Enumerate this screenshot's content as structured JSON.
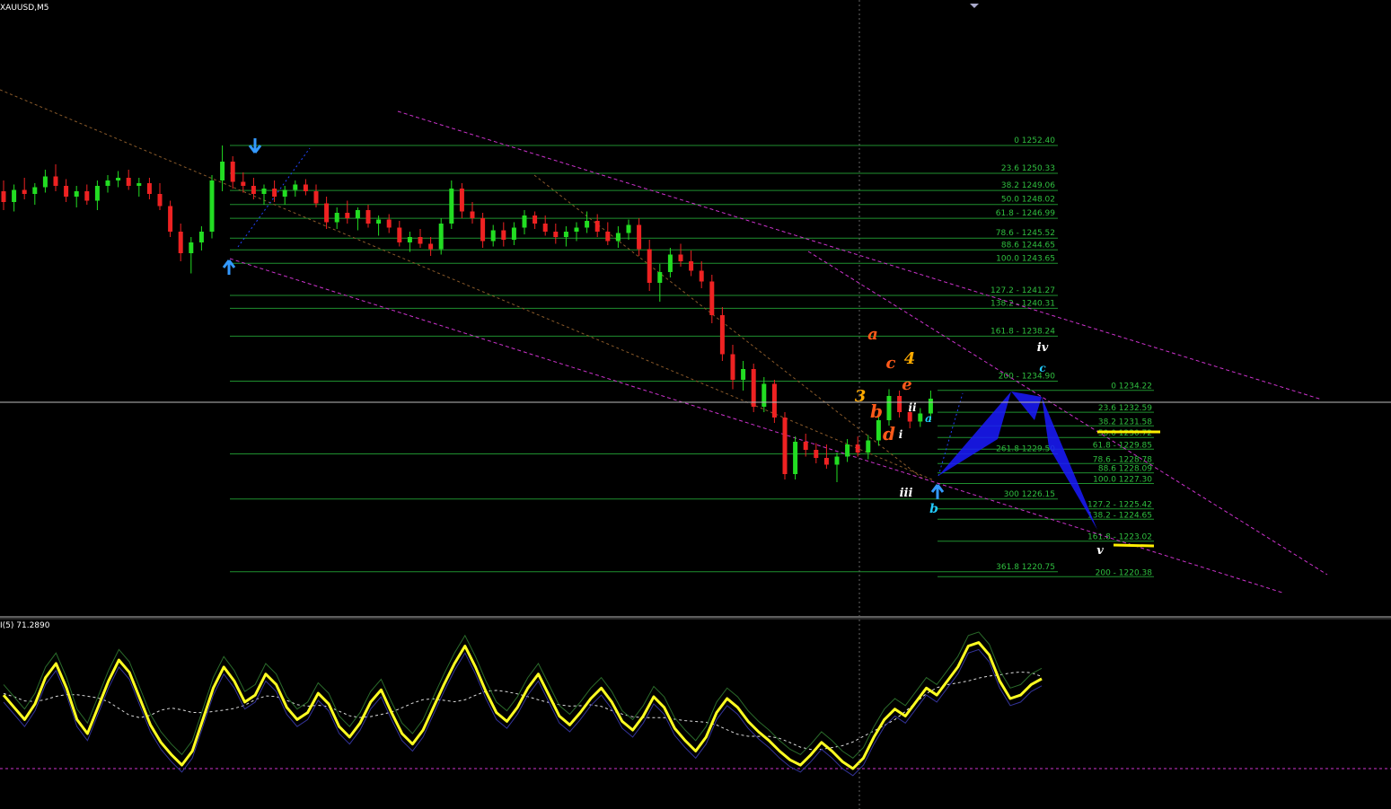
{
  "symbol_label": "XAUUSD,M5",
  "indicator_label": "I(5) 71.2890",
  "colors": {
    "background": "#000000",
    "bull": "#22dd22",
    "bear": "#ee2222",
    "fib": "#1f8f2f",
    "fib_text": "#2fbf3f",
    "channel": "#cc33cc",
    "trend": "#8a5a2a",
    "harmonic": "#1a1aff",
    "oscillator": "#ffff22",
    "arrow": "#3399ff"
  },
  "fib_left": {
    "levels": [
      {
        "price": 1252.4,
        "label": "0 1252.40"
      },
      {
        "price": 1250.33,
        "label": "23.6 1250.33"
      },
      {
        "price": 1249.06,
        "label": "38.2 1249.06"
      },
      {
        "price": 1248.02,
        "label": "50.0 1248.02"
      },
      {
        "price": 1246.99,
        "label": "61.8 - 1246.99"
      },
      {
        "price": 1245.52,
        "label": "78.6 - 1245.52"
      },
      {
        "price": 1244.65,
        "label": "88.6 1244.65"
      },
      {
        "price": 1243.65,
        "label": "100.0 1243.65"
      },
      {
        "price": 1241.27,
        "label": "127.2 - 1241.27"
      },
      {
        "price": 1240.31,
        "label": "138.2 - 1240.31"
      },
      {
        "price": 1238.24,
        "label": "161.8 - 1238.24"
      },
      {
        "price": 1234.9,
        "label": "200 - 1234.90"
      },
      {
        "price": 1229.5,
        "label": "261.8 1229.50"
      },
      {
        "price": 1226.15,
        "label": "300 1226.15"
      },
      {
        "price": 1220.75,
        "label": "361.8 1220.75"
      }
    ]
  },
  "fib_right": {
    "levels": [
      {
        "price": 1234.22,
        "label": "0 1234.22"
      },
      {
        "price": 1232.59,
        "label": "23.6 1232.59"
      },
      {
        "price": 1231.58,
        "label": "38.2 1231.58"
      },
      {
        "price": 1230.72,
        "label": "50.0 1230.72"
      },
      {
        "price": 1229.85,
        "label": "61.8 - 1229.85"
      },
      {
        "price": 1228.78,
        "label": "78.6 - 1228.78"
      },
      {
        "price": 1228.09,
        "label": "88.6 1228.09"
      },
      {
        "price": 1227.3,
        "label": "100.0 1227.30"
      },
      {
        "price": 1225.42,
        "label": "127.2 - 1225.42"
      },
      {
        "price": 1224.65,
        "label": "138.2 - 1224.65"
      },
      {
        "price": 1223.02,
        "label": "161.8 - 1223.02"
      },
      {
        "price": 1220.38,
        "label": "200 - 1220.38"
      }
    ]
  },
  "wave_labels": [
    {
      "text": "a",
      "color": "#ff5a1a"
    },
    {
      "text": "c",
      "color": "#ff5a1a"
    },
    {
      "text": "4",
      "color": "#ffaa00"
    },
    {
      "text": "e",
      "color": "#ff5a1a"
    },
    {
      "text": "3",
      "color": "#ffaa00"
    },
    {
      "text": "b",
      "color": "#ff5a1a"
    },
    {
      "text": "d",
      "color": "#ff5a1a"
    },
    {
      "text": "i",
      "color": "#ffffff"
    },
    {
      "text": "ii",
      "color": "#ffffff"
    },
    {
      "text": "iii",
      "color": "#ffffff"
    },
    {
      "text": "iv",
      "color": "#ffffff"
    },
    {
      "text": "v",
      "color": "#ffffff"
    },
    {
      "text": "a",
      "color": "#22ccff"
    },
    {
      "text": "b",
      "color": "#22ccff"
    },
    {
      "text": "c",
      "color": "#22ccff"
    }
  ],
  "chart_data": {
    "type": "candlestick",
    "title": "XAUUSD,M5",
    "price_range": [
      1216.0,
      1262.0
    ],
    "candles": [
      {
        "o": 1249.0,
        "h": 1249.8,
        "l": 1247.6,
        "c": 1248.2
      },
      {
        "o": 1248.2,
        "h": 1249.5,
        "l": 1247.5,
        "c": 1249.1
      },
      {
        "o": 1249.1,
        "h": 1250.0,
        "l": 1248.4,
        "c": 1248.8
      },
      {
        "o": 1248.8,
        "h": 1249.6,
        "l": 1248.0,
        "c": 1249.3
      },
      {
        "o": 1249.3,
        "h": 1250.6,
        "l": 1248.9,
        "c": 1250.1
      },
      {
        "o": 1250.1,
        "h": 1251.0,
        "l": 1249.0,
        "c": 1249.4
      },
      {
        "o": 1249.4,
        "h": 1249.9,
        "l": 1248.2,
        "c": 1248.6
      },
      {
        "o": 1248.6,
        "h": 1249.4,
        "l": 1247.8,
        "c": 1249.0
      },
      {
        "o": 1249.0,
        "h": 1249.5,
        "l": 1248.0,
        "c": 1248.3
      },
      {
        "o": 1248.3,
        "h": 1249.8,
        "l": 1247.6,
        "c": 1249.4
      },
      {
        "o": 1249.4,
        "h": 1250.2,
        "l": 1248.9,
        "c": 1249.8
      },
      {
        "o": 1249.8,
        "h": 1250.5,
        "l": 1249.3,
        "c": 1250.0
      },
      {
        "o": 1250.0,
        "h": 1250.6,
        "l": 1249.1,
        "c": 1249.4
      },
      {
        "o": 1249.4,
        "h": 1250.0,
        "l": 1248.6,
        "c": 1249.6
      },
      {
        "o": 1249.6,
        "h": 1250.0,
        "l": 1248.4,
        "c": 1248.8
      },
      {
        "o": 1248.8,
        "h": 1249.6,
        "l": 1247.6,
        "c": 1247.9
      },
      {
        "o": 1247.9,
        "h": 1248.3,
        "l": 1245.6,
        "c": 1246.0
      },
      {
        "o": 1246.0,
        "h": 1246.6,
        "l": 1243.8,
        "c": 1244.4
      },
      {
        "o": 1244.4,
        "h": 1245.6,
        "l": 1242.9,
        "c": 1245.2
      },
      {
        "o": 1245.2,
        "h": 1246.4,
        "l": 1244.6,
        "c": 1246.0
      },
      {
        "o": 1246.0,
        "h": 1250.2,
        "l": 1245.5,
        "c": 1249.8
      },
      {
        "o": 1249.8,
        "h": 1252.4,
        "l": 1249.0,
        "c": 1251.2
      },
      {
        "o": 1251.2,
        "h": 1251.6,
        "l": 1249.2,
        "c": 1249.7
      },
      {
        "o": 1249.7,
        "h": 1250.4,
        "l": 1248.9,
        "c": 1249.4
      },
      {
        "o": 1249.4,
        "h": 1250.0,
        "l": 1248.4,
        "c": 1248.8
      },
      {
        "o": 1248.8,
        "h": 1249.5,
        "l": 1248.0,
        "c": 1249.2
      },
      {
        "o": 1249.2,
        "h": 1249.8,
        "l": 1248.2,
        "c": 1248.6
      },
      {
        "o": 1248.6,
        "h": 1249.4,
        "l": 1248.0,
        "c": 1249.1
      },
      {
        "o": 1249.1,
        "h": 1249.8,
        "l": 1248.6,
        "c": 1249.5
      },
      {
        "o": 1249.5,
        "h": 1249.9,
        "l": 1248.7,
        "c": 1249.0
      },
      {
        "o": 1249.0,
        "h": 1249.5,
        "l": 1247.8,
        "c": 1248.1
      },
      {
        "o": 1248.1,
        "h": 1248.6,
        "l": 1246.2,
        "c": 1246.7
      },
      {
        "o": 1246.7,
        "h": 1247.8,
        "l": 1246.2,
        "c": 1247.4
      },
      {
        "o": 1247.4,
        "h": 1248.3,
        "l": 1246.6,
        "c": 1247.0
      },
      {
        "o": 1247.0,
        "h": 1247.8,
        "l": 1246.1,
        "c": 1247.6
      },
      {
        "o": 1247.6,
        "h": 1248.0,
        "l": 1246.3,
        "c": 1246.6
      },
      {
        "o": 1246.6,
        "h": 1247.2,
        "l": 1245.7,
        "c": 1246.9
      },
      {
        "o": 1246.9,
        "h": 1247.3,
        "l": 1245.9,
        "c": 1246.3
      },
      {
        "o": 1246.3,
        "h": 1246.8,
        "l": 1244.9,
        "c": 1245.2
      },
      {
        "o": 1245.2,
        "h": 1246.0,
        "l": 1244.5,
        "c": 1245.6
      },
      {
        "o": 1245.6,
        "h": 1246.2,
        "l": 1244.8,
        "c": 1245.1
      },
      {
        "o": 1245.1,
        "h": 1245.6,
        "l": 1244.2,
        "c": 1244.7
      },
      {
        "o": 1244.7,
        "h": 1247.0,
        "l": 1244.3,
        "c": 1246.6
      },
      {
        "o": 1246.6,
        "h": 1249.8,
        "l": 1246.2,
        "c": 1249.2
      },
      {
        "o": 1249.2,
        "h": 1249.6,
        "l": 1247.0,
        "c": 1247.5
      },
      {
        "o": 1247.5,
        "h": 1248.2,
        "l": 1246.6,
        "c": 1247.0
      },
      {
        "o": 1247.0,
        "h": 1247.4,
        "l": 1244.8,
        "c": 1245.3
      },
      {
        "o": 1245.3,
        "h": 1246.5,
        "l": 1244.9,
        "c": 1246.1
      },
      {
        "o": 1246.1,
        "h": 1246.7,
        "l": 1244.9,
        "c": 1245.4
      },
      {
        "o": 1245.4,
        "h": 1246.7,
        "l": 1245.0,
        "c": 1246.3
      },
      {
        "o": 1246.3,
        "h": 1247.6,
        "l": 1245.8,
        "c": 1247.2
      },
      {
        "o": 1247.2,
        "h": 1247.5,
        "l": 1246.2,
        "c": 1246.6
      },
      {
        "o": 1246.6,
        "h": 1247.2,
        "l": 1245.7,
        "c": 1246.0
      },
      {
        "o": 1246.0,
        "h": 1246.6,
        "l": 1245.1,
        "c": 1245.6
      },
      {
        "o": 1245.6,
        "h": 1246.4,
        "l": 1244.9,
        "c": 1246.0
      },
      {
        "o": 1246.0,
        "h": 1246.7,
        "l": 1245.3,
        "c": 1246.3
      },
      {
        "o": 1246.3,
        "h": 1247.5,
        "l": 1245.9,
        "c": 1246.8
      },
      {
        "o": 1246.8,
        "h": 1247.3,
        "l": 1245.6,
        "c": 1246.0
      },
      {
        "o": 1246.0,
        "h": 1246.7,
        "l": 1245.0,
        "c": 1245.3
      },
      {
        "o": 1245.3,
        "h": 1246.4,
        "l": 1244.8,
        "c": 1245.9
      },
      {
        "o": 1245.9,
        "h": 1246.9,
        "l": 1245.4,
        "c": 1246.5
      },
      {
        "o": 1246.5,
        "h": 1247.0,
        "l": 1244.2,
        "c": 1244.7
      },
      {
        "o": 1244.7,
        "h": 1245.4,
        "l": 1241.6,
        "c": 1242.2
      },
      {
        "o": 1242.2,
        "h": 1243.6,
        "l": 1240.8,
        "c": 1243.0
      },
      {
        "o": 1243.0,
        "h": 1244.8,
        "l": 1242.6,
        "c": 1244.3
      },
      {
        "o": 1244.3,
        "h": 1245.1,
        "l": 1243.4,
        "c": 1243.8
      },
      {
        "o": 1243.8,
        "h": 1244.6,
        "l": 1242.7,
        "c": 1243.1
      },
      {
        "o": 1243.1,
        "h": 1243.8,
        "l": 1241.8,
        "c": 1242.3
      },
      {
        "o": 1242.3,
        "h": 1242.8,
        "l": 1239.2,
        "c": 1239.8
      },
      {
        "o": 1239.8,
        "h": 1240.4,
        "l": 1236.4,
        "c": 1236.9
      },
      {
        "o": 1236.9,
        "h": 1237.6,
        "l": 1234.3,
        "c": 1235.0
      },
      {
        "o": 1235.0,
        "h": 1236.4,
        "l": 1234.2,
        "c": 1235.8
      },
      {
        "o": 1235.8,
        "h": 1236.2,
        "l": 1232.6,
        "c": 1233.0
      },
      {
        "o": 1233.0,
        "h": 1235.2,
        "l": 1232.6,
        "c": 1234.7
      },
      {
        "o": 1234.7,
        "h": 1235.0,
        "l": 1231.8,
        "c": 1232.2
      },
      {
        "o": 1232.2,
        "h": 1232.6,
        "l": 1227.6,
        "c": 1228.0
      },
      {
        "o": 1228.0,
        "h": 1230.8,
        "l": 1227.6,
        "c": 1230.4
      },
      {
        "o": 1230.4,
        "h": 1231.0,
        "l": 1229.3,
        "c": 1229.8
      },
      {
        "o": 1229.8,
        "h": 1230.3,
        "l": 1228.8,
        "c": 1229.2
      },
      {
        "o": 1229.2,
        "h": 1230.2,
        "l": 1228.4,
        "c": 1228.7
      },
      {
        "o": 1228.7,
        "h": 1229.6,
        "l": 1227.4,
        "c": 1229.3
      },
      {
        "o": 1229.3,
        "h": 1230.6,
        "l": 1228.9,
        "c": 1230.2
      },
      {
        "o": 1230.2,
        "h": 1230.8,
        "l": 1229.3,
        "c": 1229.6
      },
      {
        "o": 1229.6,
        "h": 1230.9,
        "l": 1229.1,
        "c": 1230.5
      },
      {
        "o": 1230.5,
        "h": 1232.4,
        "l": 1230.1,
        "c": 1232.0
      },
      {
        "o": 1232.0,
        "h": 1234.3,
        "l": 1231.6,
        "c": 1233.8
      },
      {
        "o": 1233.8,
        "h": 1234.2,
        "l": 1232.2,
        "c": 1232.6
      },
      {
        "o": 1232.6,
        "h": 1233.1,
        "l": 1231.4,
        "c": 1231.9
      },
      {
        "o": 1231.9,
        "h": 1232.9,
        "l": 1231.5,
        "c": 1232.5
      },
      {
        "o": 1232.5,
        "h": 1234.2,
        "l": 1232.0,
        "c": 1233.6
      }
    ],
    "oscillator": {
      "label": "I(5) 71.2890",
      "last_value": 71.289,
      "range": [
        0,
        100
      ],
      "level": 20,
      "values": [
        62,
        55,
        48,
        57,
        72,
        80,
        66,
        48,
        40,
        55,
        70,
        82,
        75,
        60,
        45,
        35,
        28,
        22,
        30,
        48,
        66,
        78,
        70,
        58,
        62,
        74,
        68,
        55,
        48,
        52,
        63,
        57,
        44,
        38,
        46,
        58,
        65,
        52,
        40,
        34,
        42,
        55,
        68,
        80,
        90,
        78,
        64,
        52,
        47,
        55,
        66,
        74,
        62,
        50,
        45,
        52,
        60,
        66,
        58,
        47,
        42,
        50,
        61,
        55,
        43,
        36,
        30,
        38,
        52,
        60,
        55,
        47,
        41,
        36,
        30,
        25,
        22,
        28,
        35,
        30,
        24,
        20,
        26,
        38,
        48,
        54,
        50,
        58,
        66,
        62,
        70,
        78,
        90,
        92,
        85,
        70,
        60,
        62,
        68,
        71.289
      ]
    }
  }
}
